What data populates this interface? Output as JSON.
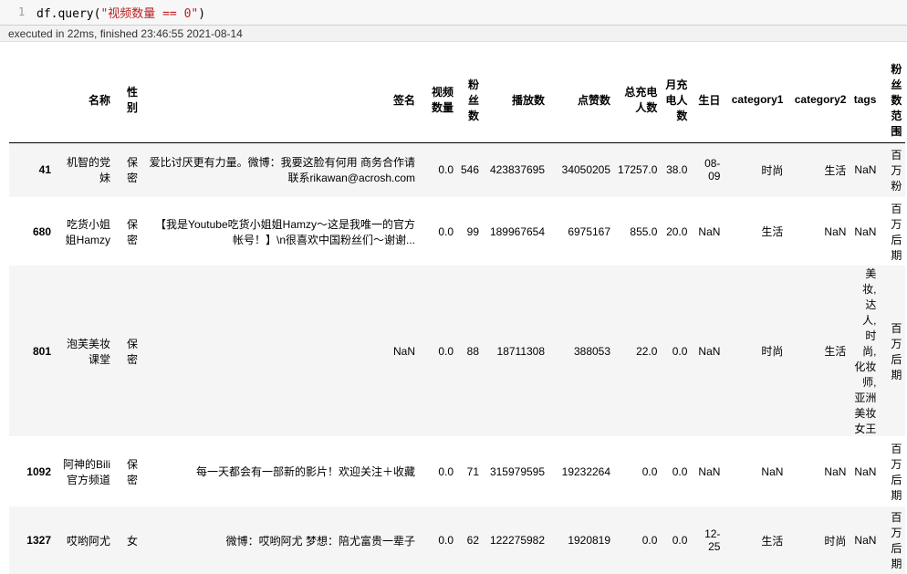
{
  "cell": {
    "line_number": "1",
    "code_prefix": "df.query(",
    "code_string": "\"视频数量 == 0\"",
    "code_suffix": ")",
    "exec_info": "executed in 22ms, finished 23:46:55 2021-08-14"
  },
  "table": {
    "columns": [
      "名称",
      "性别",
      "签名",
      "视频数量",
      "粉丝数",
      "播放数",
      "点赞数",
      "总充电人数",
      "月充电人数",
      "生日",
      "category1",
      "category2",
      "tags",
      "粉丝数范围"
    ],
    "rows": [
      {
        "index": "41",
        "name": "机智的党妹",
        "sex": "保密",
        "sig": "爱比讨厌更有力量。微博：我要这脸有何用 商务合作请联系rikawan@acrosh.com",
        "videos": "0.0",
        "fans": "546",
        "plays": "423837695",
        "likes": "34050205",
        "total_charge": "17257.0",
        "month_charge": "38.0",
        "birthday": "08-09",
        "cat1": "时尚",
        "cat2": "生活",
        "tags": "NaN",
        "range": "百万粉"
      },
      {
        "index": "680",
        "name": "吃货小姐姐Hamzy",
        "sex": "保密",
        "sig": "【我是Youtube吃货小姐姐Hamzy～这是我唯一的官方帐号！】\\n很喜欢中国粉丝们～谢谢...",
        "videos": "0.0",
        "fans": "99",
        "plays": "189967654",
        "likes": "6975167",
        "total_charge": "855.0",
        "month_charge": "20.0",
        "birthday": "NaN",
        "cat1": "生活",
        "cat2": "NaN",
        "tags": "NaN",
        "range": "百万后期"
      },
      {
        "index": "801",
        "name": "泡芙美妆课堂",
        "sex": "保密",
        "sig": "NaN",
        "videos": "0.0",
        "fans": "88",
        "plays": "18711308",
        "likes": "388053",
        "total_charge": "22.0",
        "month_charge": "0.0",
        "birthday": "NaN",
        "cat1": "时尚",
        "cat2": "生活",
        "tags": "美妆,达人,时尚,化妆师,亚洲美妆女王",
        "range": "百万后期"
      },
      {
        "index": "1092",
        "name": "阿神的Bili官方频道",
        "sex": "保密",
        "sig": "每一天都会有一部新的影片！欢迎关注＋收藏",
        "videos": "0.0",
        "fans": "71",
        "plays": "315979595",
        "likes": "19232264",
        "total_charge": "0.0",
        "month_charge": "0.0",
        "birthday": "NaN",
        "cat1": "NaN",
        "cat2": "NaN",
        "tags": "NaN",
        "range": "百万后期"
      },
      {
        "index": "1327",
        "name": "哎哟阿尤",
        "sex": "女",
        "sig": "微博：哎哟阿尤 梦想：陪尤富贵一辈子",
        "videos": "0.0",
        "fans": "62",
        "plays": "122275982",
        "likes": "1920819",
        "total_charge": "0.0",
        "month_charge": "0.0",
        "birthday": "12-25",
        "cat1": "生活",
        "cat2": "时尚",
        "tags": "NaN",
        "range": "百万后期"
      }
    ]
  }
}
